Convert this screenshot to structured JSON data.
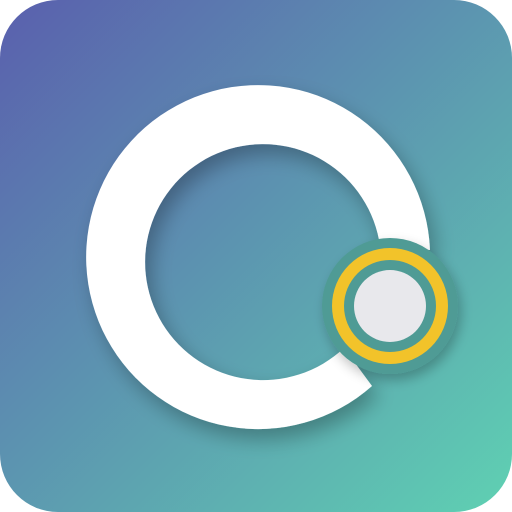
{
  "app_icon": {
    "icon_name": "ring-with-dot-app-icon",
    "colors": {
      "gradient_top_left": "#5a5fae",
      "gradient_bottom_right": "#5fd1b2",
      "ring": "#ffffff",
      "dot_outer": "#f2c32a",
      "dot_inner": "#e8e8ec",
      "dot_backing": "#4f9b95",
      "outer_background": "#ffffff"
    }
  }
}
